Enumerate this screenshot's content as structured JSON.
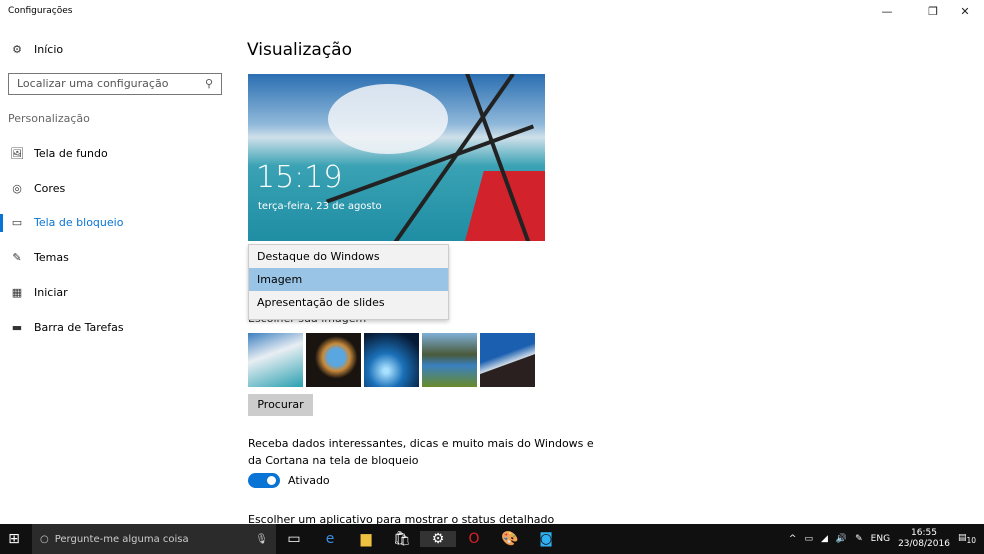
{
  "window": {
    "title": "Configurações",
    "minimize": "—",
    "maximize": "❐",
    "close": "✕"
  },
  "sidebar": {
    "home": "Início",
    "search_placeholder": "Localizar uma configuração",
    "section": "Personalização",
    "items": [
      {
        "label": "Tela de fundo",
        "icon": "🖼"
      },
      {
        "label": "Cores",
        "icon": "◎"
      },
      {
        "label": "Tela de bloqueio",
        "icon": "▭"
      },
      {
        "label": "Temas",
        "icon": "✎"
      },
      {
        "label": "Iniciar",
        "icon": "▦"
      },
      {
        "label": "Barra de Tarefas",
        "icon": "▬"
      }
    ]
  },
  "main": {
    "title": "Visualização",
    "clock": "15:19",
    "date": "terça-feira, 23 de agosto",
    "dropdown": [
      "Destaque do Windows",
      "Imagem",
      "Apresentação de slides"
    ],
    "selected": "Imagem",
    "choose_image": "Escolher sua imagem",
    "browse": "Procurar",
    "tips_text": "Receba dados interessantes, dicas e muito mais do Windows e da Cortana na tela de bloqueio",
    "toggle_label": "Ativado",
    "toggle_on": true,
    "app_status": "Escolher um aplicativo para mostrar o status detalhado"
  },
  "taskbar": {
    "search": "Pergunte-me alguma coisa",
    "lang": "ENG",
    "time": "16:55",
    "date": "23/08/2016",
    "notif_count": "10"
  }
}
